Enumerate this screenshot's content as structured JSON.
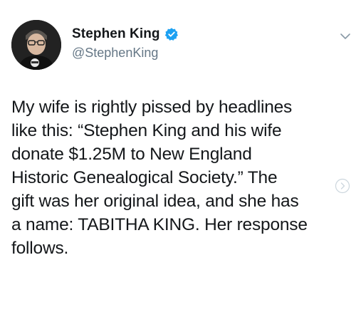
{
  "author": {
    "display_name": "Stephen King",
    "handle": "@StephenKing",
    "verified": true,
    "avatar_icon": "profile-photo-icon"
  },
  "tweet": {
    "text": "My wife is rightly pissed by headlines\nlike this: “Stephen King and his wife\ndonate $1.25M to New England\nHistoric Genealogical Society.” The\ngift was her original idea, and she has\na name: TABITHA KING. Her response\nfollows."
  },
  "icons": {
    "verified": "verified-badge-icon",
    "menu": "chevron-down-icon",
    "next": "chevron-right-circle-icon"
  },
  "colors": {
    "verified_blue": "#1da1f2",
    "handle_gray": "#657786",
    "text": "#14171a",
    "faint_gray": "#ccd6dd"
  }
}
